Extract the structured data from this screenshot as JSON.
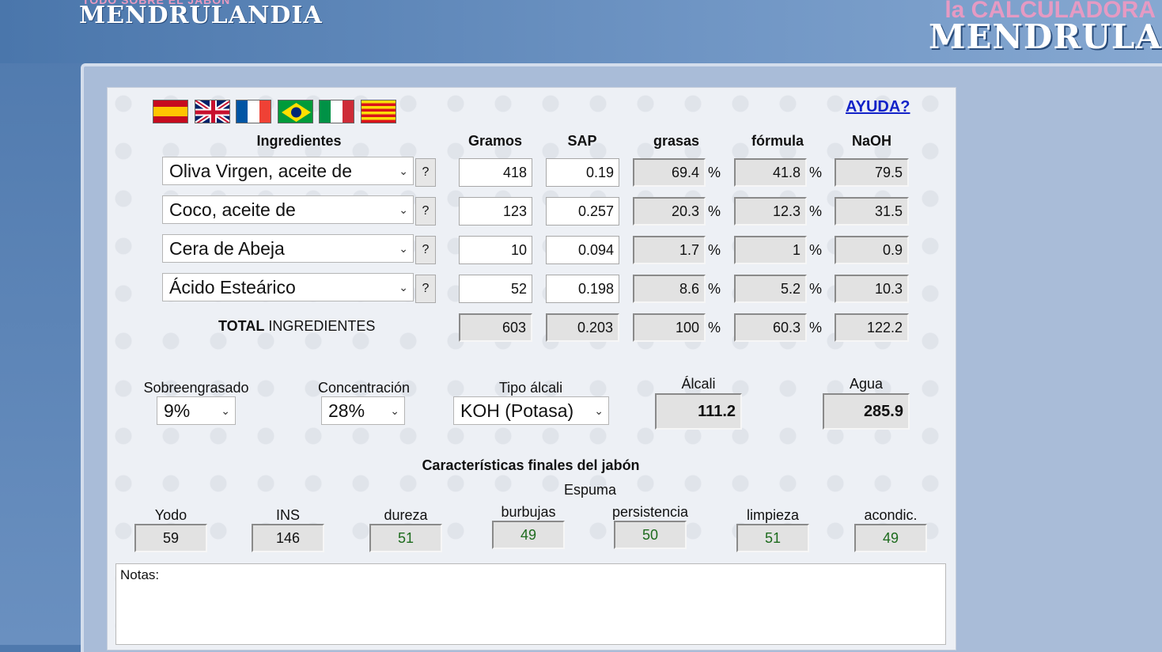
{
  "banner": {
    "left_sub": "TODO SOBRE EL JABÓN",
    "left_title": "MENDRULANDIA",
    "right_sub": "la CALCULADORA",
    "right_title": "MENDRULA"
  },
  "flags": [
    "spain-flag-icon",
    "uk-flag-icon",
    "france-flag-icon",
    "brazil-flag-icon",
    "italy-flag-icon",
    "catalonia-flag-icon"
  ],
  "help_link": "AYUDA?",
  "headers": {
    "ingredientes": "Ingredientes",
    "gramos": "Gramos",
    "sap": "SAP",
    "grasas": "grasas",
    "formula": "fórmula",
    "naoh": "NaOH"
  },
  "rows": [
    {
      "ingredient": "Oliva Virgen, aceite de",
      "help": "?",
      "gramos": "418",
      "sap": "0.19",
      "grasas": "69.4",
      "formula": "41.8",
      "naoh": "79.5"
    },
    {
      "ingredient": "Coco, aceite de",
      "help": "?",
      "gramos": "123",
      "sap": "0.257",
      "grasas": "20.3",
      "formula": "12.3",
      "naoh": "31.5"
    },
    {
      "ingredient": "Cera de Abeja",
      "help": "?",
      "gramos": "10",
      "sap": "0.094",
      "grasas": "1.7",
      "formula": "1",
      "naoh": "0.9"
    },
    {
      "ingredient": "Ácido Esteárico",
      "help": "?",
      "gramos": "52",
      "sap": "0.198",
      "grasas": "8.6",
      "formula": "5.2",
      "naoh": "10.3"
    }
  ],
  "percent_sign": "%",
  "total": {
    "label_bold": "TOTAL",
    "label_rest": " INGREDIENTES",
    "gramos": "603",
    "sap": "0.203",
    "grasas": "100",
    "formula": "60.3",
    "naoh": "122.2"
  },
  "params": {
    "sobreengrasado_label": "Sobreengrasado",
    "sobreengrasado_value": "9%",
    "concentracion_label": "Concentración",
    "concentracion_value": "28%",
    "tipo_alcali_label": "Tipo álcali",
    "tipo_alcali_value": "KOH (Potasa)",
    "alcali_label": "Álcali",
    "alcali_value": "111.2",
    "agua_label": "Agua",
    "agua_value": "285.9"
  },
  "characteristics": {
    "title": "Características finales del jabón",
    "espuma_label": "Espuma",
    "items": [
      {
        "label": "Yodo",
        "value": "59"
      },
      {
        "label": "INS",
        "value": "146"
      },
      {
        "label": "dureza",
        "value": "51"
      },
      {
        "label": "burbujas",
        "value": "49"
      },
      {
        "label": "persistencia",
        "value": "50"
      },
      {
        "label": "limpieza",
        "value": "51"
      },
      {
        "label": "acondic.",
        "value": "49"
      }
    ]
  },
  "notes_placeholder": "Notas:"
}
